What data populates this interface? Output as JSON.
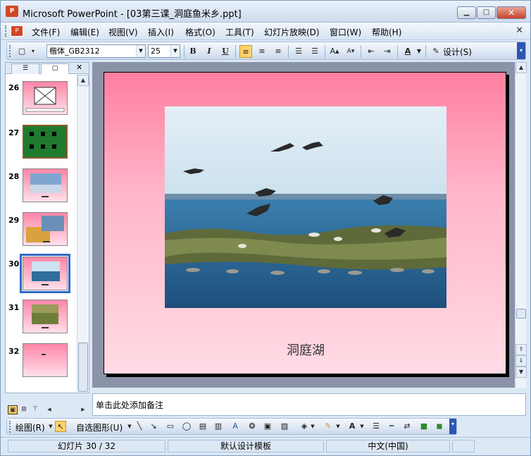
{
  "window": {
    "title": "Microsoft PowerPoint - [03第三课_洞庭鱼米乡.ppt]",
    "app_icon": "powerpoint-icon",
    "controls": {
      "minimize": "▁",
      "maximize": "□",
      "close": "✕"
    }
  },
  "menu": {
    "items": [
      "文件(F)",
      "编辑(E)",
      "视图(V)",
      "插入(I)",
      "格式(O)",
      "工具(T)",
      "幻灯片放映(D)",
      "窗口(W)",
      "帮助(H)"
    ],
    "close_glyph": "✕"
  },
  "format_toolbar": {
    "font_name": "楷体_GB2312",
    "font_size": "25",
    "bold": "B",
    "italic": "I",
    "underline": "U",
    "align_left_active": true,
    "design_label": "设计(S)"
  },
  "slides_panel": {
    "close_glyph": "✕",
    "slides": [
      {
        "number": "26"
      },
      {
        "number": "27"
      },
      {
        "number": "28"
      },
      {
        "number": "29"
      },
      {
        "number": "30",
        "selected": true
      },
      {
        "number": "31"
      },
      {
        "number": "32"
      }
    ]
  },
  "slide": {
    "caption": "洞庭湖"
  },
  "notes": {
    "placeholder": "单击此处添加备注"
  },
  "drawing_toolbar": {
    "draw_label": "绘图(R)",
    "autoshape_label": "自选图形(U)"
  },
  "status": {
    "slide_pos": "幻灯片 30 / 32",
    "template": "默认设计模板",
    "language": "中文(中国)"
  }
}
